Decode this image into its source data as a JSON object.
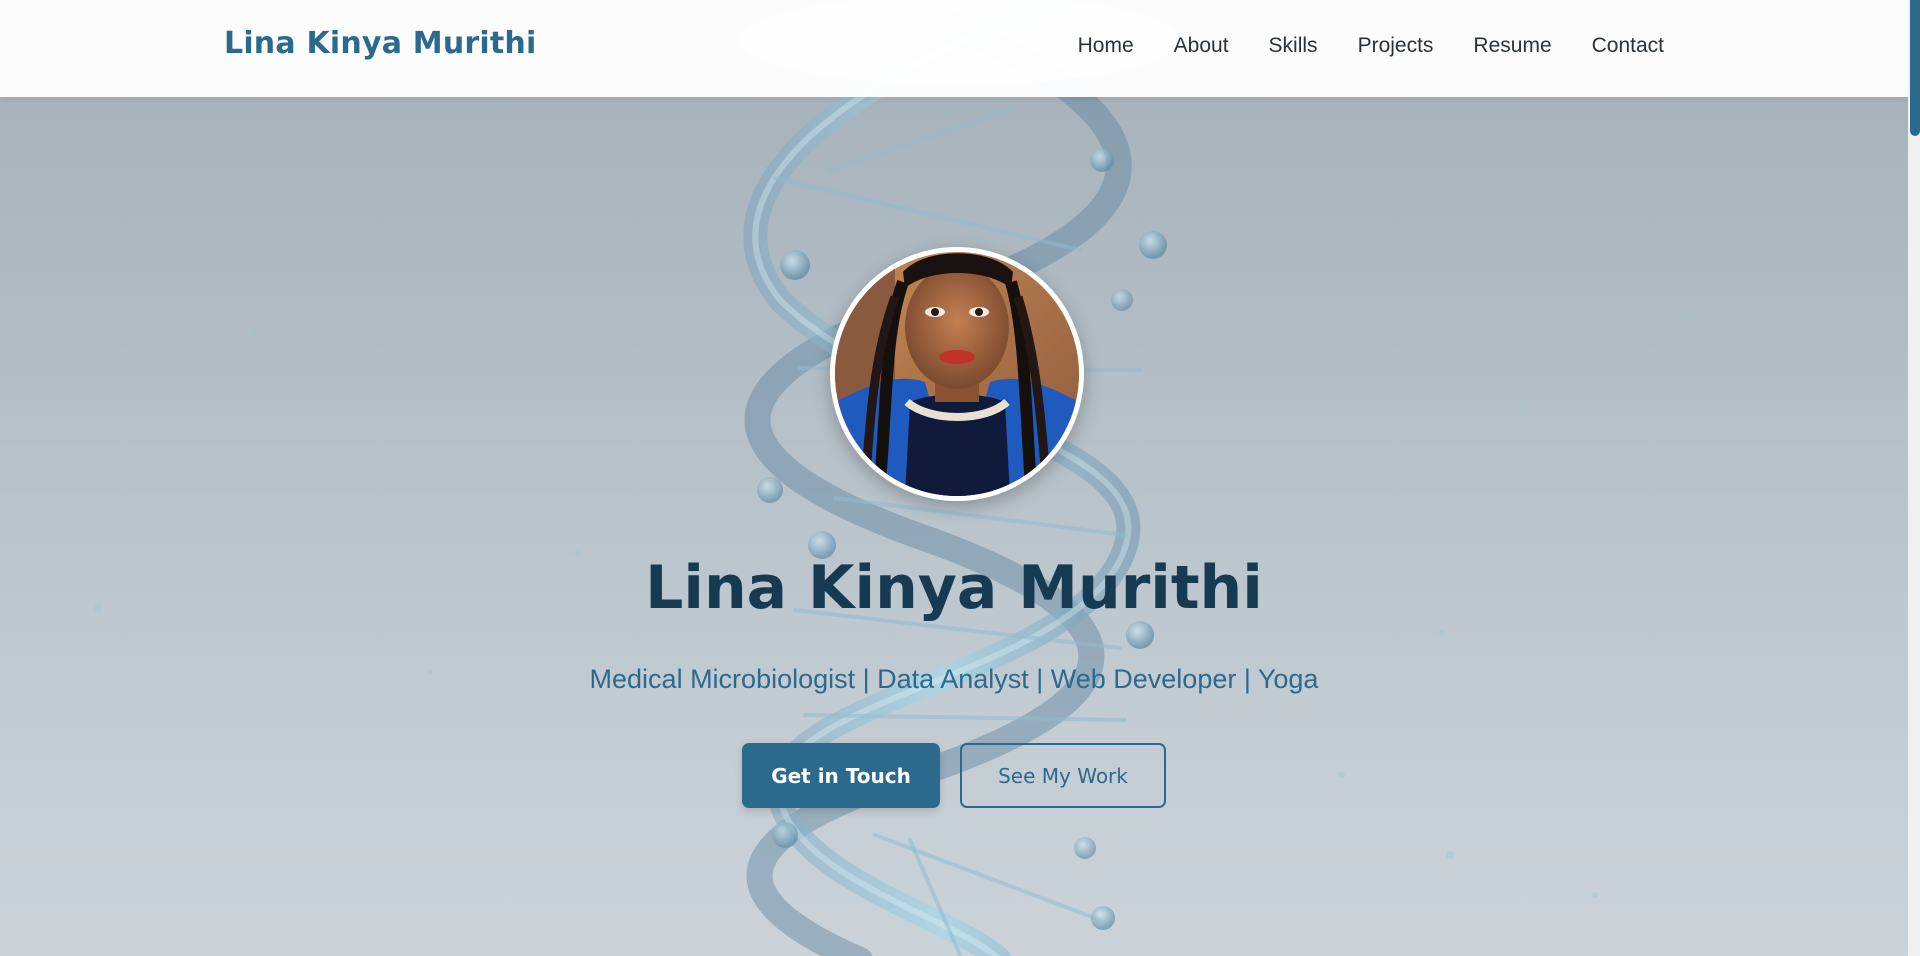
{
  "header": {
    "brand": "Lina Kinya Murithi",
    "nav": [
      "Home",
      "About",
      "Skills",
      "Projects",
      "Resume",
      "Contact"
    ]
  },
  "hero": {
    "title": "Lina Kinya Murithi",
    "subtitle": "Medical Microbiologist | Data Analyst | Web Developer | Yoga",
    "primary_button": "Get in Touch",
    "secondary_button": "See My Work",
    "background_image": "dna-helix-illustration",
    "avatar_image": "profile-photo"
  },
  "colors": {
    "accent": "#2b6a8d",
    "title": "#163a52",
    "nav_text": "#2c3338",
    "header_bg": "#ffffff"
  }
}
